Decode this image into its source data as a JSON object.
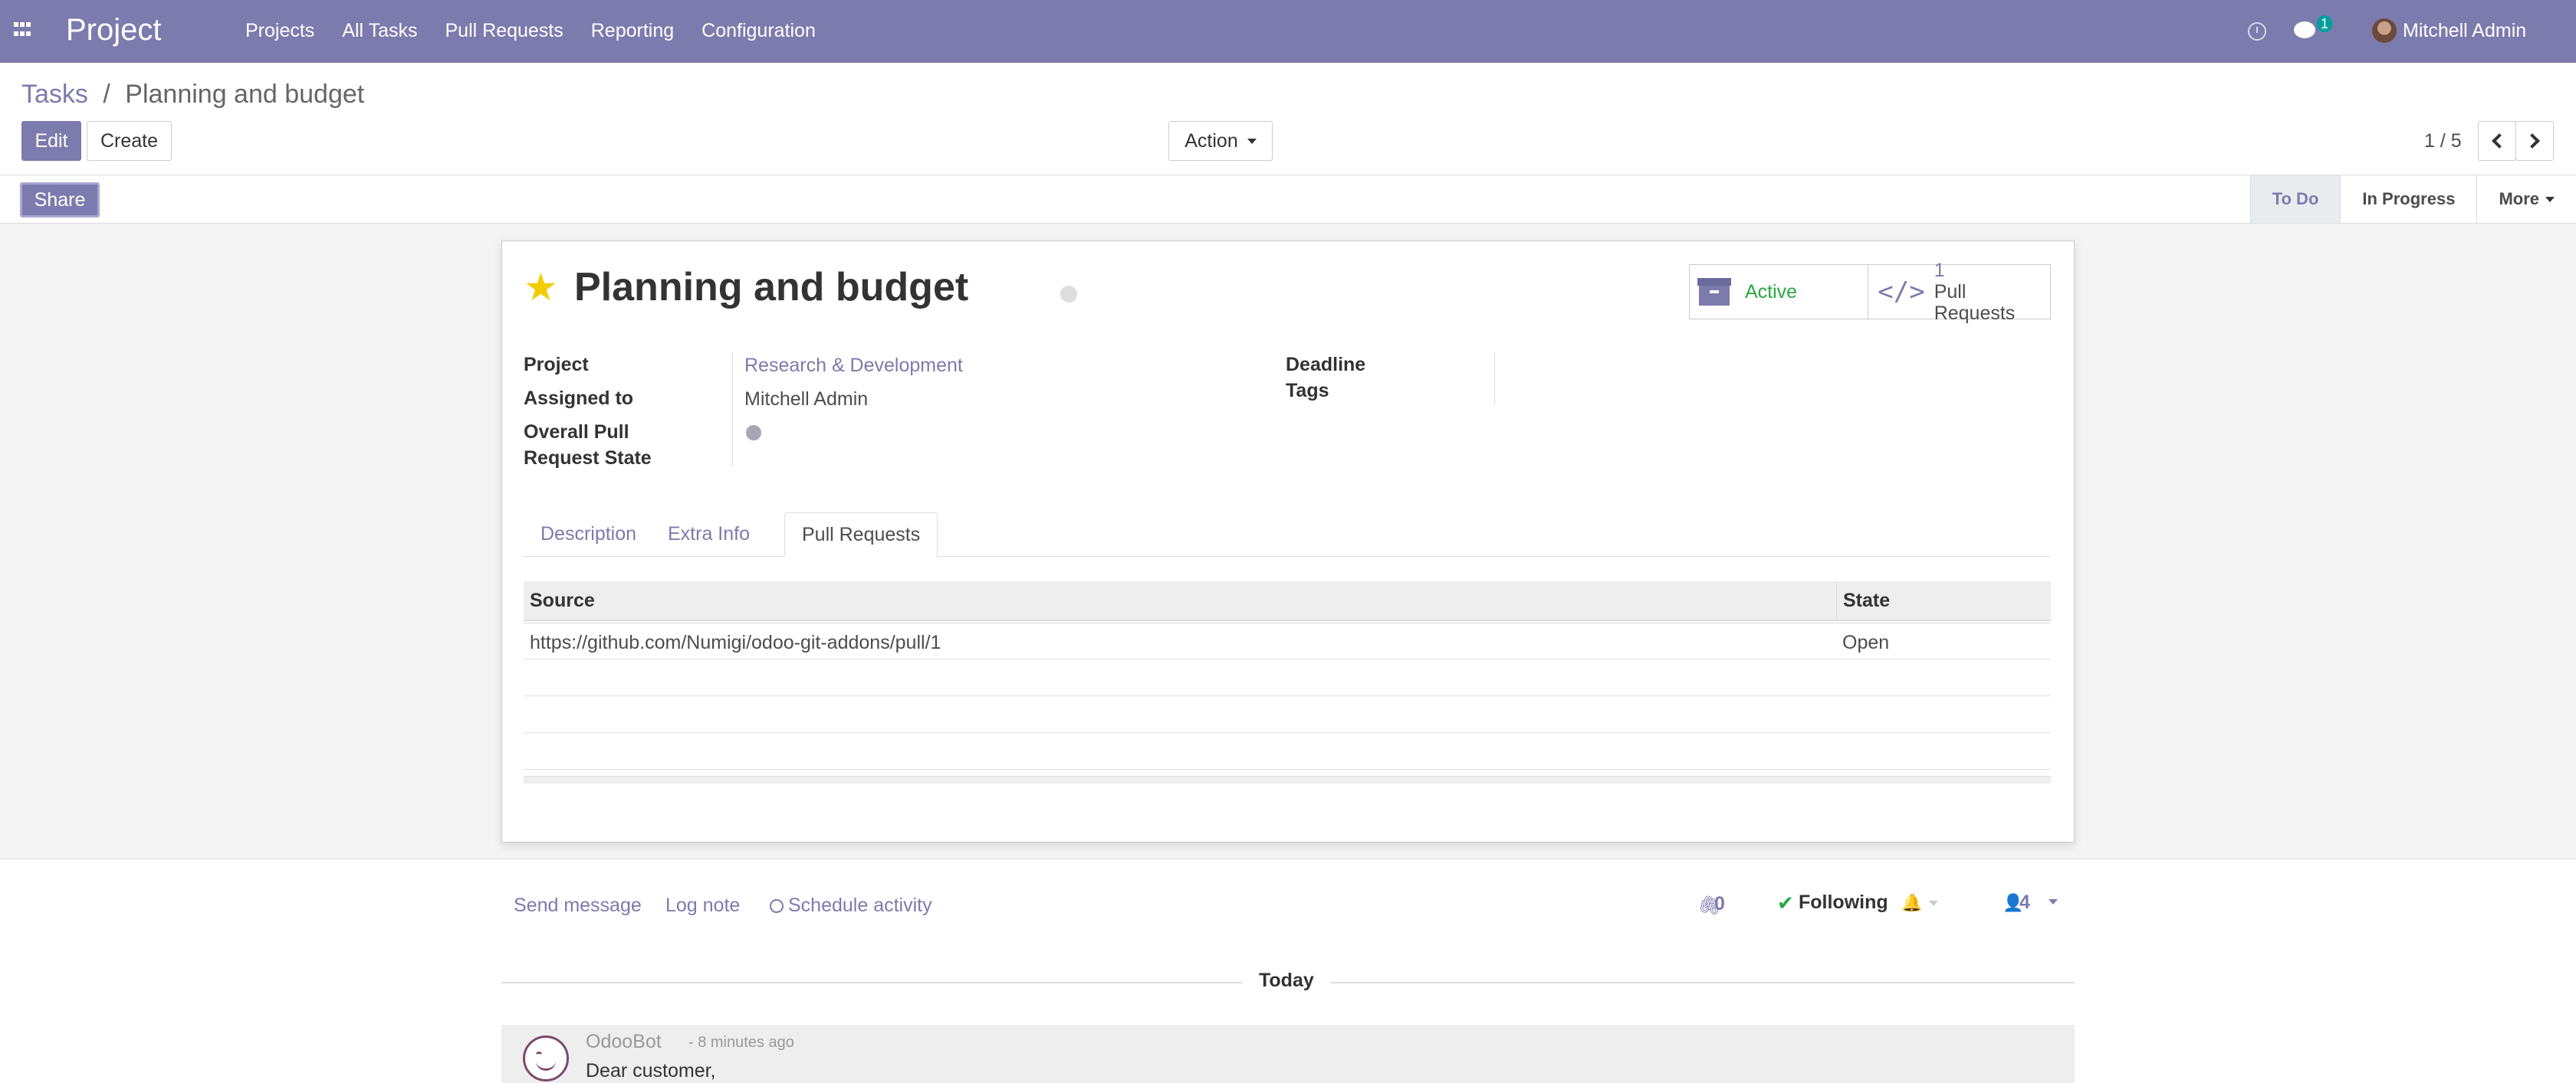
{
  "navbar": {
    "app_title": "Project",
    "menu": [
      "Projects",
      "All Tasks",
      "Pull Requests",
      "Reporting",
      "Configuration"
    ],
    "messages_badge": "1",
    "user_name": "Mitchell Admin"
  },
  "breadcrumb": {
    "parent": "Tasks",
    "separator": "/",
    "current": "Planning and budget"
  },
  "buttons": {
    "edit": "Edit",
    "create": "Create",
    "action": "Action",
    "share": "Share"
  },
  "pager": {
    "value": "1 / 5"
  },
  "stages": {
    "items": [
      "To Do",
      "In Progress"
    ],
    "more": "More"
  },
  "task": {
    "title": "Planning and budget",
    "smart_buttons": {
      "active_label": "Active",
      "pr_count": "1",
      "pr_label": "Pull Requests"
    },
    "fields": {
      "project_label": "Project",
      "project_value": "Research & Development",
      "assigned_label": "Assigned to",
      "assigned_value": "Mitchell Admin",
      "pr_state_label_line1": "Overall Pull",
      "pr_state_label_line2": "Request State",
      "deadline_label": "Deadline",
      "tags_label": "Tags"
    },
    "tabs": [
      "Description",
      "Extra Info",
      "Pull Requests"
    ],
    "pull_requests": {
      "columns": [
        "Source",
        "State"
      ],
      "rows": [
        {
          "source": "https://github.com/Numigi/odoo-git-addons/pull/1",
          "state": "Open"
        }
      ]
    }
  },
  "chatter": {
    "send_message": "Send message",
    "log_note": "Log note",
    "schedule_activity": "Schedule activity",
    "attachments_count": "0",
    "following": "Following",
    "followers_count": "4",
    "date_separator": "Today",
    "message": {
      "author": "OdooBot",
      "date": "- 8 minutes ago",
      "body": "Dear customer,"
    }
  },
  "colors": {
    "brand": "#7c7bad",
    "success": "#28a745",
    "star": "#f3cc00"
  }
}
